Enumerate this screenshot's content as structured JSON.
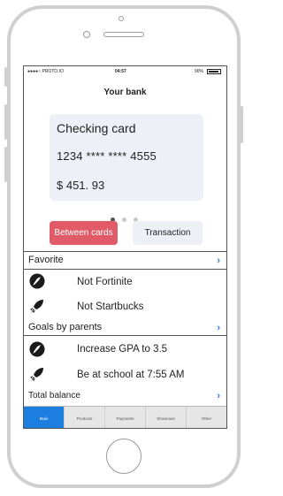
{
  "status_bar": {
    "carrier": "●●●●○ PROTO.IO",
    "time": "04:57",
    "battery": "90%"
  },
  "header": {
    "title": "Your bank"
  },
  "card": {
    "name": "Checking card",
    "number": "1234 **** **** 4555",
    "balance": "$ 451. 93"
  },
  "pager": {
    "count": 3,
    "active": 0
  },
  "actions": {
    "between_label": "Between cards",
    "transaction_label": "Transaction",
    "between_color": "#e05a67"
  },
  "favorite": {
    "title": "Favorite",
    "items": [
      {
        "label": "Not Fortinite",
        "icon": "globe-rocket-icon"
      },
      {
        "label": "Not Startbucks",
        "icon": "rocket-icon"
      }
    ]
  },
  "goals": {
    "title": "Goals by parents",
    "items": [
      {
        "label": "Increase GPA to 3.5",
        "icon": "globe-rocket-icon"
      },
      {
        "label": "Be at school at 7:55 AM",
        "icon": "rocket-icon"
      }
    ]
  },
  "total": {
    "title": "Total balance"
  },
  "tabs": [
    "Main",
    "Products",
    "Payments",
    "Showcase",
    "Other"
  ],
  "colors": {
    "accent": "#1c7ede",
    "card_bg": "#edf1f7",
    "chevron": "#2a7ad8"
  }
}
